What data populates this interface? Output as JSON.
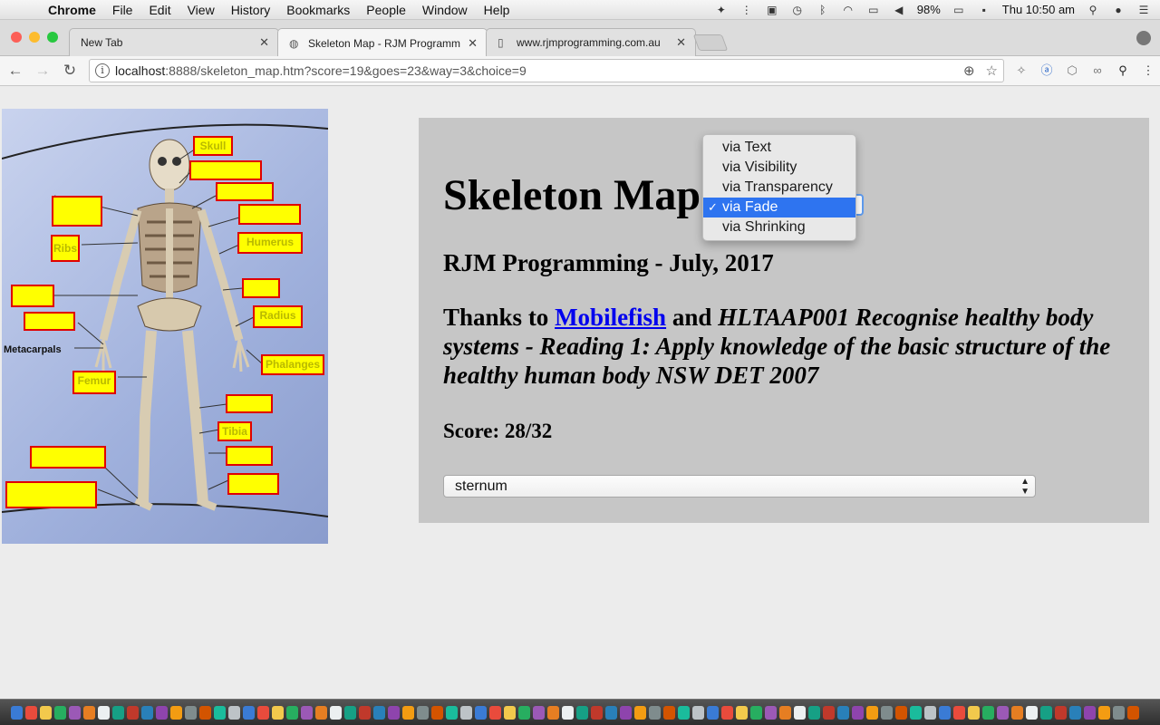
{
  "menubar": {
    "app": "Chrome",
    "items": [
      "File",
      "Edit",
      "View",
      "History",
      "Bookmarks",
      "People",
      "Window",
      "Help"
    ],
    "battery": "98%",
    "clock": "Thu 10:50 am"
  },
  "tabs": [
    {
      "title": "New Tab"
    },
    {
      "title": "Skeleton Map - RJM Programm"
    },
    {
      "title": "www.rjmprogramming.com.au"
    }
  ],
  "address": {
    "host": "localhost",
    "rest": ":8888/skeleton_map.htm?score=19&goes=23&way=3&choice=9"
  },
  "skeleton": {
    "labels": [
      "Skull",
      "Ribs",
      "Humerus",
      "Radius",
      "Phalanges",
      "Femur",
      "Tibia"
    ],
    "metacarpals": "Metacarpals"
  },
  "panel": {
    "title": "Skeleton Map",
    "subtitle": "RJM Programming - July, 2017",
    "thanks_prefix": "Thanks to ",
    "thanks_link": "Mobilefish",
    "thanks_mid": " and ",
    "thanks_italic": "HLTAAP001 Recognise healthy body systems - Reading 1: Apply knowledge of the basic structure of the healthy human body NSW DET 2007",
    "score": "Score: 28/32",
    "choice_value": "sternum"
  },
  "way_menu": {
    "options": [
      "via Text",
      "via Visibility",
      "via Transparency",
      "via Fade",
      "via Shrinking"
    ],
    "selected": "via Fade",
    "check": "✓"
  },
  "colors": {
    "label_fill": "#ffff00",
    "label_border": "#e00000",
    "menu_highlight": "#2e74f0",
    "link": "#0000ee"
  }
}
